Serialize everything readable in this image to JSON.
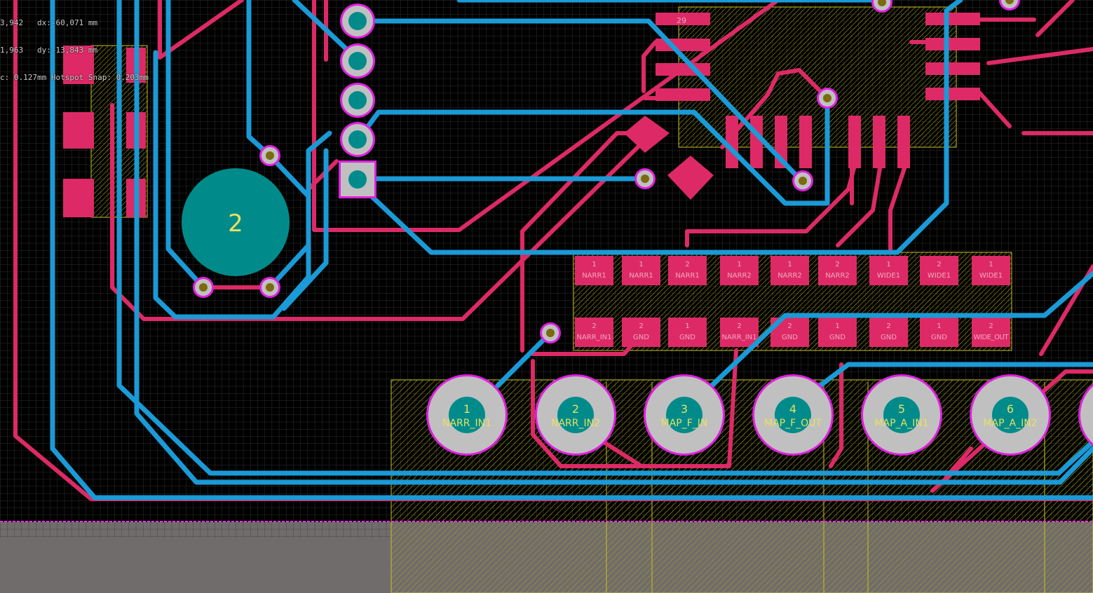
{
  "hud": {
    "line1": "3,942   dx:-60,071 mm",
    "line2": "1,963   dy:-13,843 mm",
    "line3": "c: 0.127mm Hotspot Snap: 0.203mm"
  },
  "colors": {
    "background": "#000000",
    "grid": "#2e2e2e",
    "top_copper": "#dd2a66",
    "bottom_copper": "#1a9ad6",
    "pad_fill": "#c0c0c0",
    "pad_ring": "#e020e0",
    "drill": "#008b8b",
    "silk_hatch": "#c8c020",
    "board_outline": "#ff30ff",
    "board_outside": "#706c6c"
  },
  "big_pad": {
    "label": "2"
  },
  "ic_pin": {
    "label": "29"
  },
  "smd_top": [
    {
      "num": "1",
      "net": "NARR1"
    },
    {
      "num": "1",
      "net": "NARR1"
    },
    {
      "num": "2",
      "net": "NARR1"
    },
    {
      "num": "1",
      "net": "NARR2"
    },
    {
      "num": "1",
      "net": "NARR2"
    },
    {
      "num": "2",
      "net": "NARR2"
    },
    {
      "num": "1",
      "net": "WIDE1"
    },
    {
      "num": "2",
      "net": "WIDE1"
    },
    {
      "num": "1",
      "net": "WIDE1"
    }
  ],
  "smd_bottom": [
    {
      "num": "2",
      "net": "NARR_IN1"
    },
    {
      "num": "2",
      "net": "GND"
    },
    {
      "num": "1",
      "net": "GND"
    },
    {
      "num": "2",
      "net": "NARR_IN1"
    },
    {
      "num": "2",
      "net": "GND"
    },
    {
      "num": "1",
      "net": "GND"
    },
    {
      "num": "2",
      "net": "GND"
    },
    {
      "num": "1",
      "net": "GND"
    },
    {
      "num": "2",
      "net": "WIDE_OUT"
    }
  ],
  "through_holes": [
    {
      "num": "1",
      "net": "NARR_IN1"
    },
    {
      "num": "2",
      "net": "NARR_IN2"
    },
    {
      "num": "3",
      "net": "MAP_F_IN"
    },
    {
      "num": "4",
      "net": "MAP_F_OUT"
    },
    {
      "num": "5",
      "net": "MAP_A_IN1"
    },
    {
      "num": "6",
      "net": "MAP_A_IN2"
    }
  ]
}
